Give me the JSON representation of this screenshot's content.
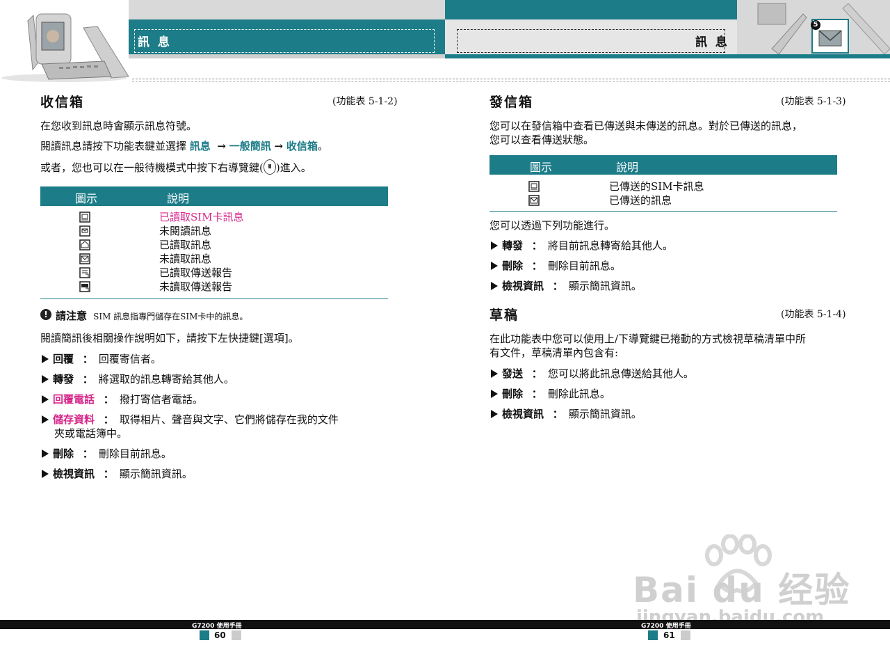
{
  "header": {
    "left_title": "訊 息",
    "right_title": "訊 息",
    "chapter_badge": "5"
  },
  "left": {
    "section_title": "收信箱",
    "menu_ref": "(功能表 5-1-2)",
    "intro": "在您收到訊息時會顯示訊息符號。",
    "nav_prefix": "閱讀訊息請按下功能表鍵並選擇",
    "nav_1": "訊息",
    "nav_arrow": "→",
    "nav_2": "一般簡訊",
    "nav_3": "收信箱",
    "nav_end": "。",
    "alt_prefix": "或者，您也可以在一般待機模式中按下右導覽鍵(",
    "alt_suffix": ")進入。",
    "table": {
      "col_icon": "圖示",
      "col_desc": "說明",
      "rows": [
        {
          "icon": "sim-read-icon",
          "desc": "已讀取SIM卡訊息"
        },
        {
          "icon": "sim-unread-icon",
          "desc": "未閱讀訊息"
        },
        {
          "icon": "read-message-icon",
          "desc": "已讀取訊息"
        },
        {
          "icon": "unread-message-icon",
          "desc": "未讀取訊息"
        },
        {
          "icon": "read-report-icon",
          "desc": "已讀取傳送報告"
        },
        {
          "icon": "unread-report-icon",
          "desc": "未讀取傳送報告"
        }
      ]
    },
    "note_label": "請注意",
    "note_text": "SIM 訊息指專門儲存在SIM卡中的訊息。",
    "after_table": "閱讀簡訊後相關操作說明如下，請按下左快捷鍵[選項]。",
    "options": [
      {
        "label": "回覆",
        "sep": "：",
        "text": "回覆寄信者。"
      },
      {
        "label": "轉發",
        "sep": "：",
        "text": "將選取的訊息轉寄給其他人。"
      },
      {
        "label": "回覆電話",
        "sep": "：",
        "text": "撥打寄信者電話。"
      },
      {
        "label": "儲存資料",
        "sep": "：",
        "text": "取得相片、聲音與文字、它們將儲存在我的文件",
        "text2": "夾或電話簿中。"
      },
      {
        "label": "刪除",
        "sep": "：",
        "text": "刪除目前訊息。"
      },
      {
        "label": "檢視資訊",
        "sep": "：",
        "text": "顯示簡訊資訊。"
      }
    ]
  },
  "right": {
    "section_title": "發信箱",
    "menu_ref": "(功能表 5-1-3)",
    "intro_1": "您可以在發信箱中查看已傳送與未傳送的訊息。對於已傳送的訊息，",
    "intro_2": "您可以查看傳送狀態。",
    "table": {
      "col_icon": "圖示",
      "col_desc": "說明",
      "rows": [
        {
          "icon": "sent-sim-icon",
          "desc": "已傳送的SIM卡訊息"
        },
        {
          "icon": "sent-message-icon",
          "desc": "已傳送的訊息"
        }
      ]
    },
    "after_table": "您可以透過下列功能進行。",
    "options": [
      {
        "label": "轉發",
        "sep": "：",
        "text": "將目前訊息轉寄給其他人。"
      },
      {
        "label": "刪除",
        "sep": "：",
        "text": "刪除目前訊息。"
      },
      {
        "label": "檢視資訊",
        "sep": "：",
        "text": "顯示簡訊資訊。"
      }
    ],
    "section2_title": "草稿",
    "menu_ref2": "(功能表 5-1-4)",
    "draft_1": "在此功能表中您可以使用上/下導覽鍵已捲動的方式檢視草稿清單中所",
    "draft_2": "有文件，草稿清單內包含有:",
    "options2": [
      {
        "label": "發送",
        "sep": "：",
        "text": "您可以將此訊息傳送給其他人。"
      },
      {
        "label": "刪除",
        "sep": "：",
        "text": "刪除此訊息。"
      },
      {
        "label": "檢視資訊",
        "sep": "：",
        "text": "顯示簡訊資訊。"
      }
    ]
  },
  "footer": {
    "manual_left": "G7200  使用手冊",
    "manual_right": "G7200  使用手冊",
    "page_left": "60",
    "page_right": "61"
  },
  "watermark": {
    "brand": "Bai du 经验",
    "url": "jingyan.baidu.com"
  },
  "colors": {
    "accent": "#1c7c88",
    "highlight": "#d6268a"
  }
}
